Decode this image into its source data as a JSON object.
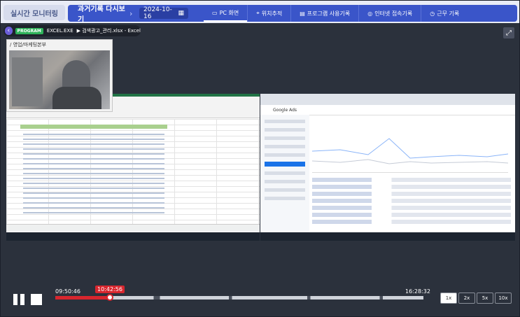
{
  "topbar": {
    "live_tab": "실시간 모니터링",
    "nav_title": "과거기록 다시보기",
    "date": "2024-10-16",
    "tabs": [
      {
        "icon": "monitor-icon",
        "label": "PC 화면",
        "active": true
      },
      {
        "icon": "location-pin-icon",
        "label": "위치추적",
        "active": false
      },
      {
        "icon": "program-icon",
        "label": "프로그램 사용기록",
        "active": false
      },
      {
        "icon": "internet-icon",
        "label": "인터넷 접속기록",
        "active": false
      },
      {
        "icon": "clock-icon",
        "label": "근무 기록",
        "active": false
      }
    ]
  },
  "viewer": {
    "program_badge": "PROGRAM",
    "program_name": "EXCEL.EXE",
    "window_title": "▶ 검색광고_관리.xlsx - Excel",
    "webcam_label": "/ 영업/마케팅본부",
    "right_app": "Google Ads"
  },
  "playback": {
    "start_time": "09:50:46",
    "current_time": "10:42:56",
    "end_time": "16:28:32",
    "progress_fraction": 0.148,
    "speeds": [
      "1x",
      "2x",
      "5x",
      "10x"
    ],
    "active_speed": "1x"
  },
  "colors": {
    "nav_blue": "#3a55c9",
    "progress_red": "#d8262e",
    "excel_green": "#217346"
  }
}
